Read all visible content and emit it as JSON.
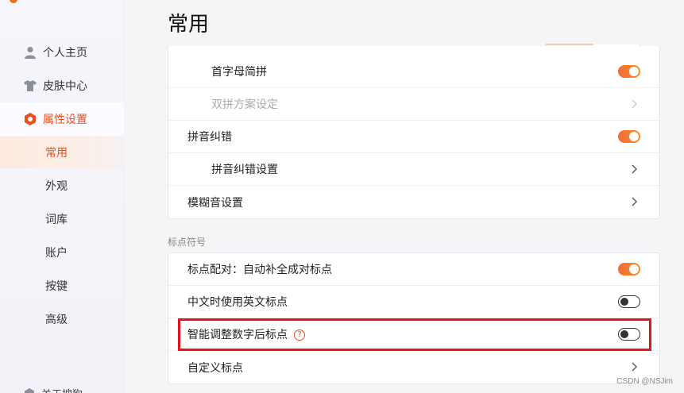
{
  "sidebar": {
    "items": [
      {
        "label": "个人主页",
        "icon": "user-icon"
      },
      {
        "label": "皮肤中心",
        "icon": "shirt-icon"
      },
      {
        "label": "属性设置",
        "icon": "hexagon-settings-icon"
      }
    ],
    "subitems": [
      "常用",
      "外观",
      "词库",
      "账户",
      "按键",
      "高级"
    ],
    "active_subitem": "常用",
    "bottom_item": "关于搜狗"
  },
  "main": {
    "title": "常用",
    "card_top": {
      "rows": [
        {
          "label": "首字母简拼",
          "control": "toggle",
          "state": "on",
          "indent": true
        },
        {
          "label": "双拼方案设定",
          "control": "chevron",
          "indent": true,
          "disabled": true
        },
        {
          "label": "拼音纠错",
          "control": "toggle",
          "state": "on",
          "indent": false
        },
        {
          "label": "拼音纠错设置",
          "control": "chevron",
          "indent": true
        },
        {
          "label": "模糊音设置",
          "control": "chevron",
          "indent": false
        }
      ]
    },
    "section_label": "标点符号",
    "card_bottom": {
      "rows": [
        {
          "label": "标点配对：自动补全成对标点",
          "control": "toggle",
          "state": "on"
        },
        {
          "label": "中文时使用英文标点",
          "control": "toggle",
          "state": "off"
        },
        {
          "label": "智能调整数字后标点",
          "control": "toggle",
          "state": "off",
          "help": "?"
        },
        {
          "label": "自定义标点",
          "control": "chevron"
        }
      ]
    }
  },
  "watermark": "CSDN @NSJim",
  "colors": {
    "accent": "#e8501a",
    "highlight_border": "#e8131a"
  }
}
